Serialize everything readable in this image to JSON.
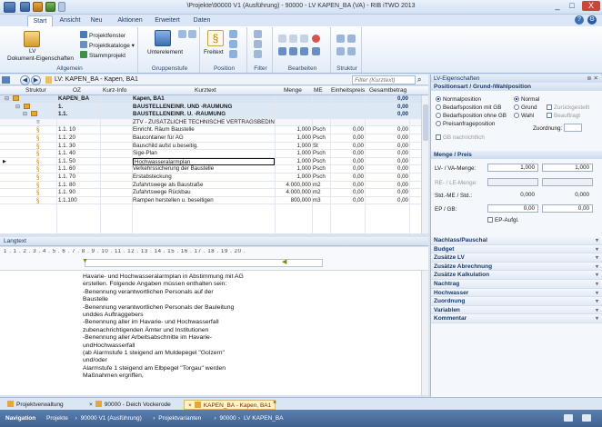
{
  "window": {
    "title": "\\Projekte\\90000 V1 (Ausführung) - 90000 - LV KAPEN_BA (VA) - RIB iTWO 2013",
    "buttons": [
      "_",
      "□",
      "X"
    ]
  },
  "ribbon": {
    "tabs": [
      "Start",
      "Ansicht",
      "Neu",
      "Aktionen",
      "Erweitert",
      "Daten"
    ],
    "active_tab": "Start",
    "groups": {
      "allgemein": {
        "label": "Allgemein",
        "lv_doc_line1": "LV",
        "lv_doc_line2": "Dokument-Eigenschaften",
        "projektfenster": "Projektfenster",
        "projektkataloge": "Projektkataloge",
        "stammprojekt": "Stammprojekt"
      },
      "gruppenstufe": {
        "label": "Gruppenstufe",
        "unterelement": "Unterelement"
      },
      "position": {
        "label": "Position",
        "freitext": "Freitext"
      },
      "filter": {
        "label": "Filter"
      },
      "bearbeiten": {
        "label": "Bearbeiten"
      },
      "struktur": {
        "label": "Struktur"
      }
    }
  },
  "nav": {
    "breadcrumb": "LV: KAPEN_BA - Kapen, BA1",
    "filter_placeholder": "Filter (Kurztext)"
  },
  "grid": {
    "columns": [
      "Struktur",
      "OZ",
      "Kurz-Info",
      "Kurztext",
      "Menge",
      "ME",
      "Einheitspreis",
      "Gesamtbetrag"
    ],
    "rows": [
      {
        "oz": "KAPEN_BA",
        "kurztext": "Kapen, BA1",
        "menge": "",
        "me": "",
        "ep": "",
        "gb": "0,00",
        "type": "root"
      },
      {
        "oz": "1.",
        "kurztext": "BAUSTELLENEINR. UND -RÄUMUNG",
        "menge": "",
        "me": "",
        "ep": "",
        "gb": "0,00",
        "type": "group"
      },
      {
        "oz": "1.1.",
        "kurztext": "BAUSTELLENEINR. U. -RÄUMUNG",
        "menge": "",
        "me": "",
        "ep": "",
        "gb": "0,00",
        "type": "group"
      },
      {
        "oz": "",
        "kurztext": "ZTV - ZUSÄTZLICHE TECHNISCHE VERTRAGSBEDING",
        "menge": "",
        "me": "",
        "ep": "",
        "gb": "",
        "type": "text"
      },
      {
        "oz": "1.1. 10",
        "kurztext": "Einricht. Räum Baustelle",
        "menge": "1,000",
        "me": "Psch",
        "ep": "0,00",
        "gb": "0,00",
        "type": "pos"
      },
      {
        "oz": "1.1. 20",
        "kurztext": "Baucontainer für AG",
        "menge": "1,000",
        "me": "Psch",
        "ep": "0,00",
        "gb": "0,00",
        "type": "pos"
      },
      {
        "oz": "1.1. 30",
        "kurztext": "Bauschild aufst u.beseitig.",
        "menge": "1,000",
        "me": "St",
        "ep": "0,00",
        "gb": "0,00",
        "type": "pos"
      },
      {
        "oz": "1.1. 40",
        "kurztext": "Sige-Plan",
        "menge": "1,000",
        "me": "Psch",
        "ep": "0,00",
        "gb": "0,00",
        "type": "pos"
      },
      {
        "oz": "1.1. 50",
        "kurztext": "Hochwasseralarmplan",
        "menge": "1,000",
        "me": "Psch",
        "ep": "0,00",
        "gb": "0,00",
        "type": "pos",
        "selected": true
      },
      {
        "oz": "1.1. 60",
        "kurztext": "Verkehrssicherung der Baustelle",
        "menge": "1,000",
        "me": "Psch",
        "ep": "0,00",
        "gb": "0,00",
        "type": "pos"
      },
      {
        "oz": "1.1. 70",
        "kurztext": "Erstabsteckung",
        "menge": "1,000",
        "me": "Psch",
        "ep": "0,00",
        "gb": "0,00",
        "type": "pos"
      },
      {
        "oz": "1.1. 80",
        "kurztext": "Zufahrtswege als Baustraße",
        "menge": "4.000,000",
        "me": "m2",
        "ep": "0,00",
        "gb": "0,00",
        "type": "pos"
      },
      {
        "oz": "1.1. 90",
        "kurztext": "Zufahrtswege Rückbau",
        "menge": "4.000,000",
        "me": "m2",
        "ep": "0,00",
        "gb": "0,00",
        "type": "pos"
      },
      {
        "oz": "1.1.100",
        "kurztext": "Rampen herstellen u. beseitigen",
        "menge": "800,000",
        "me": "m3",
        "ep": "0,00",
        "gb": "0,00",
        "type": "pos"
      }
    ]
  },
  "langtext": {
    "header": "Langtext",
    "ruler": "1 . 1 . 2 . 3 . 4 . 5 . 6 . 7 . 8 . 9 . 10 . 11 . 12 . 13 . 14 . 15 . 16 . 17 . 18 . 19 . 20 .",
    "lines": [
      "Havarie- und Hochwasseralarmplan in Abstimmung mit AG",
      "erstellen. Folgende Angaben müssen enthalten sein:",
      "-Benennung verantwortlichen Personals auf der",
      "Baustelle",
      "-Benennung verantwortlichen Personals der Bauleitung",
      "unddes Auftraggebers",
      "-Benennung aller im Havarie- und Hochwasserfall",
      "zubenachrichtigenden Ämter und Institutionen",
      "-Benennung aller Arbeitsabschnitte im Havarie-",
      "undHochwasserfall",
      "(ab Alarmstufe 1 steigend am Muldepegel \"Golzern\"",
      "und/oder",
      "Alarmstufe 1 steigend am Elbpegel \"Torgau\" werden",
      "Maßnahmen ergriffen,"
    ]
  },
  "right_panel": {
    "header": "LV-Eigenschaften",
    "section1": "Positionsart / Grund-/Wahlposition",
    "positionsart": [
      "Normalposition",
      "Bedarfsposition mit GB",
      "Bedarfsposition ohne GB",
      "Preisanfrageposition"
    ],
    "wahl": [
      "Normal",
      "Grund",
      "Wahl"
    ],
    "checks_right": [
      "Zurückgestellt",
      "Beauftragt"
    ],
    "zuordnung_label": "Zuordnung:",
    "gb_nachrichtlich": "GB nachrichtlich",
    "section2": "Menge / Preis",
    "lv_va_menge_label": "LV- / VA-Menge:",
    "lv_va_menge_1": "1,000",
    "lv_va_menge_2": "1,000",
    "re_le_menge_label": "RE- / LE-Menge:",
    "std_me_label": "Std.-ME / Std.:",
    "std_1": "0,000",
    "std_2": "0,000",
    "ep_gb_label": "EP / GB:",
    "ep": "0,00",
    "gb": "0,00",
    "ep_aufgl": "EP-Aufgl.",
    "collapsed": [
      "Nachlass/Pauschal",
      "Budget",
      "Zusätze LV",
      "Zusätze Abrechnung",
      "Zusätze Kalkulation",
      "Nachtrag",
      "Hochwasser",
      "Zuordnung",
      "Variablen",
      "Kommentar"
    ]
  },
  "doc_tabs": [
    "Projektverwaltung",
    "90000 - Deich Vockerode",
    "KAPEN_BA - Kapen, BA1"
  ],
  "statusbar": {
    "items": [
      "Navigation",
      "Projekte",
      "90000 V1 (Ausführung)",
      "Projektvarianten",
      "90000",
      "LV KAPEN_BA"
    ]
  }
}
